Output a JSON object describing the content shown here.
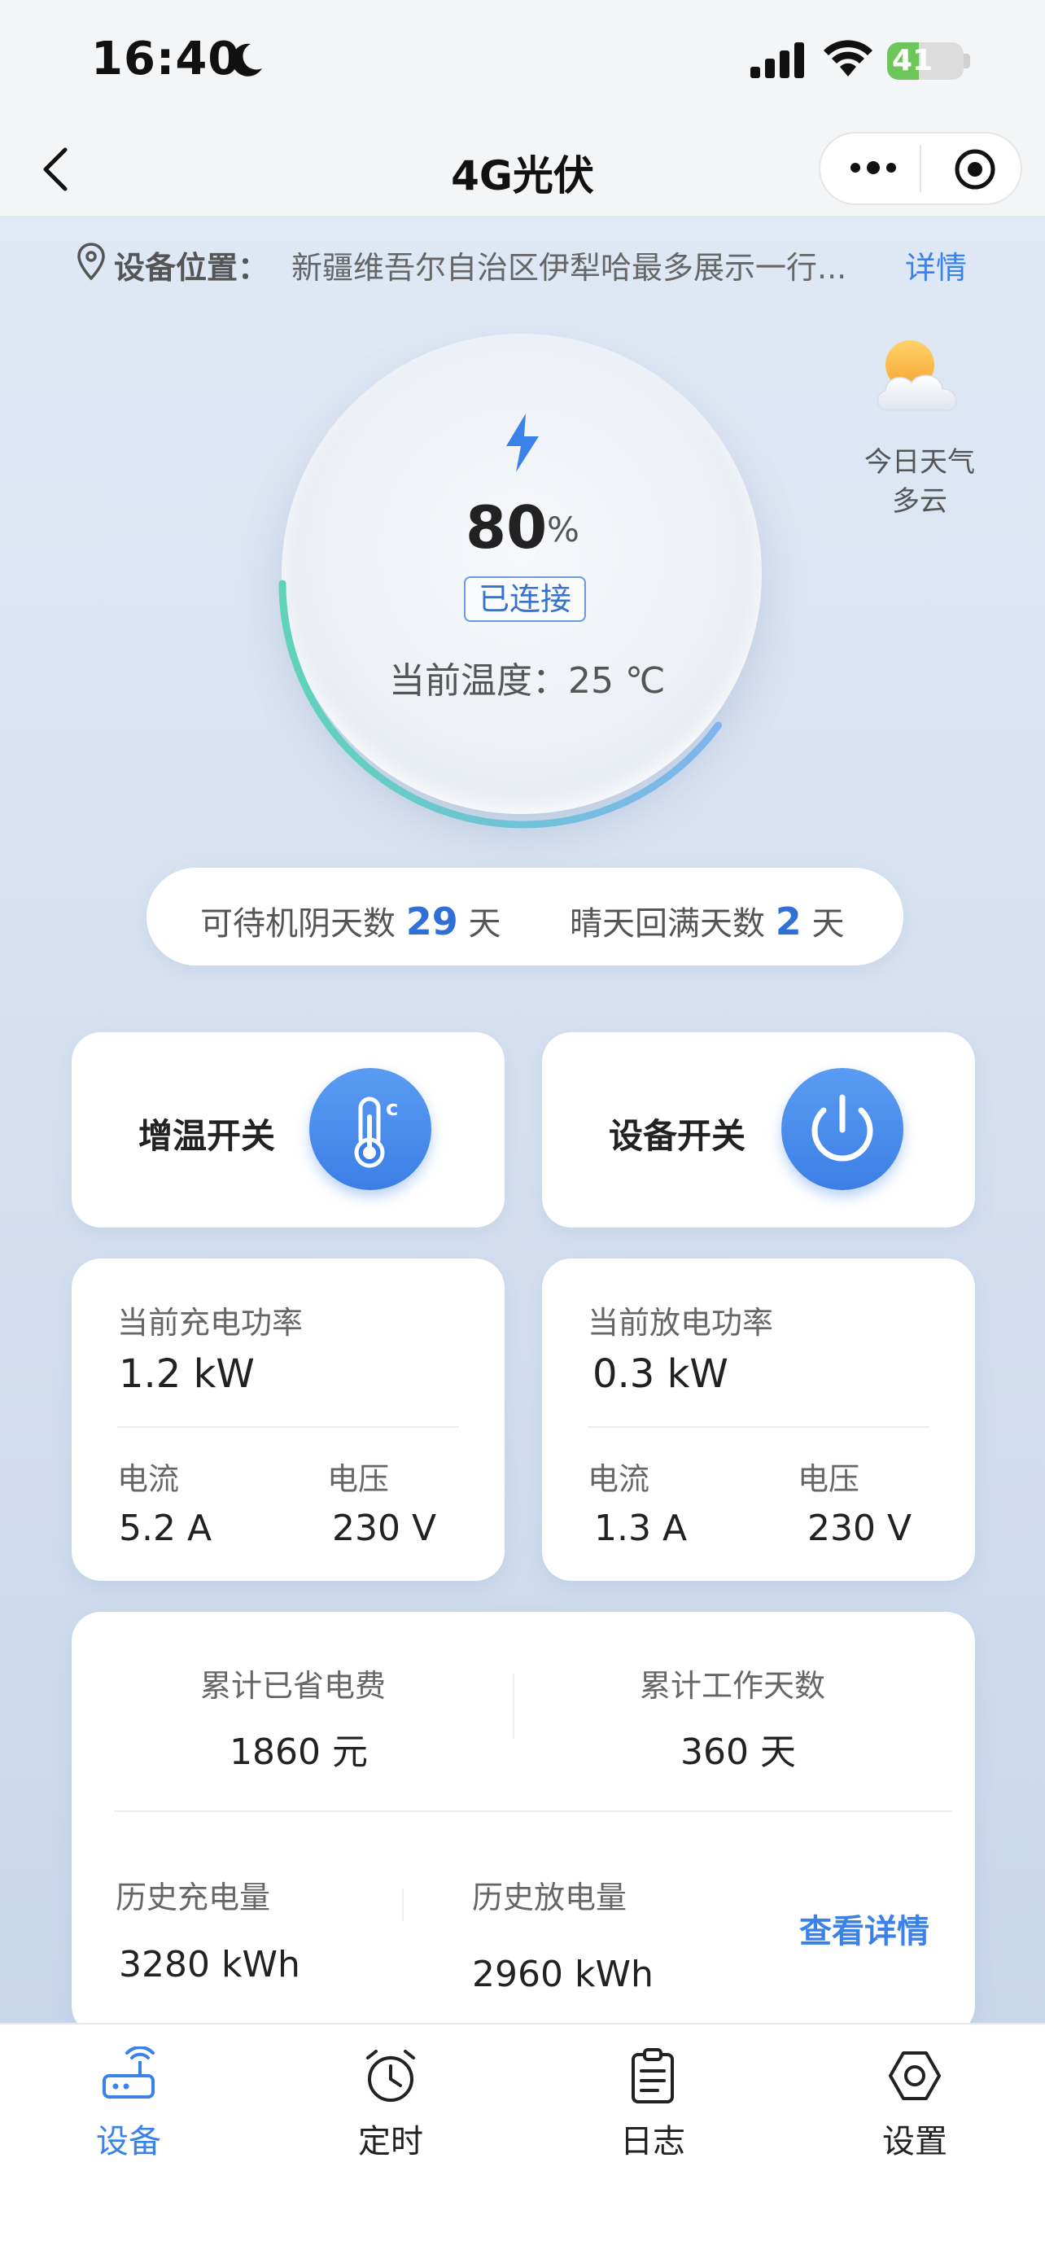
{
  "status_bar": {
    "time": "16:40",
    "battery": "41",
    "battery_level": 0.41
  },
  "nav": {
    "title": "4G光伏"
  },
  "location": {
    "label": "设备位置：",
    "value": "新疆维吾尔自治区伊犁哈最多展示一行...",
    "detail": "详情"
  },
  "weather": {
    "title": "今日天气",
    "value": "多云"
  },
  "gauge": {
    "percent": "80",
    "unit": "%",
    "status": "已连接",
    "temperature": "当前温度：25 ℃",
    "level": 0.8
  },
  "days": {
    "standby_label": "可待机阴天数",
    "standby_value": "29",
    "standby_unit": "天",
    "recharge_label": "晴天回满天数",
    "recharge_value": "2",
    "recharge_unit": "天"
  },
  "switches": {
    "heat_label": "增温开关",
    "power_label": "设备开关"
  },
  "charge": {
    "title": "当前充电功率",
    "power": "1.2 kW",
    "current_label": "电流",
    "current": "5.2 A",
    "voltage_label": "电压",
    "voltage": "230 V"
  },
  "discharge": {
    "title": "当前放电功率",
    "power": "0.3 kW",
    "current_label": "电流",
    "current": "1.3 A",
    "voltage_label": "电压",
    "voltage": "230 V"
  },
  "summary": {
    "saved_label": "累计已省电费",
    "saved_value": "1860 元",
    "days_label": "累计工作天数",
    "days_value": "360 天",
    "hist_charge_label": "历史充电量",
    "hist_charge_value": "3280 kWh",
    "hist_discharge_label": "历史放电量",
    "hist_discharge_value": "2960 kWh",
    "detail_link": "查看详情"
  },
  "tabs": [
    {
      "label": "设备",
      "icon": "router-icon",
      "active": true
    },
    {
      "label": "定时",
      "icon": "alarm-clock-icon",
      "active": false
    },
    {
      "label": "日志",
      "icon": "clipboard-icon",
      "active": false
    },
    {
      "label": "设置",
      "icon": "hexagon-settings-icon",
      "active": false
    }
  ],
  "colors": {
    "accent": "#3b82e8",
    "gauge_gradient_start": "#5fd3b9",
    "gauge_gradient_end": "#7fb4f0"
  }
}
